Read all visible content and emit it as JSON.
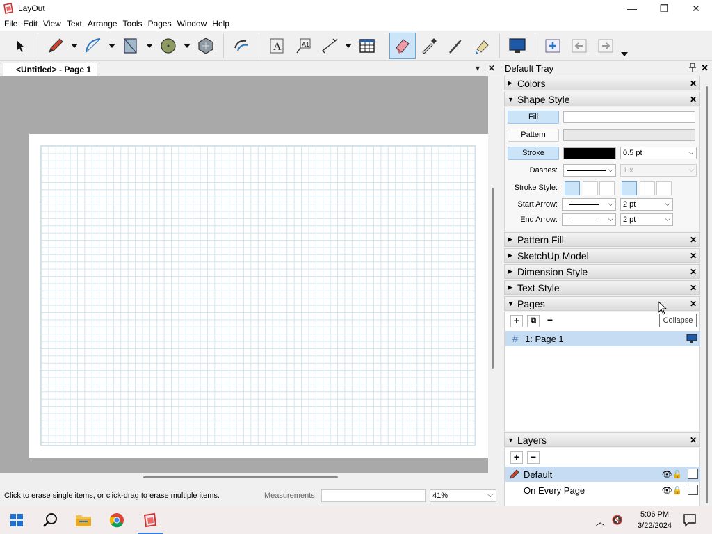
{
  "window": {
    "title": "LayOut",
    "minimize": "—",
    "maximize": "❐",
    "close": "✕"
  },
  "menu": [
    "File",
    "Edit",
    "View",
    "Text",
    "Arrange",
    "Tools",
    "Pages",
    "Window",
    "Help"
  ],
  "document": {
    "tab_label": "<Untitled> - Page 1",
    "tab_menu": "▾",
    "tab_close": "✕"
  },
  "status": {
    "hint": "Click to erase single items, or click-drag to erase multiple items.",
    "measurements_label": "Measurements",
    "measurements_value": "",
    "zoom": "41%"
  },
  "tray": {
    "title": "Default Tray",
    "pin": "📌",
    "close": "✕",
    "panels": {
      "colors": "Colors",
      "shape_style": "Shape Style",
      "pattern_fill": "Pattern Fill",
      "sketchup_model": "SketchUp Model",
      "dimension_style": "Dimension Style",
      "text_style": "Text Style",
      "pages": "Pages",
      "layers": "Layers"
    },
    "shape_style": {
      "fill_label": "Fill",
      "pattern_label": "Pattern",
      "stroke_label": "Stroke",
      "stroke_width": "0.5 pt",
      "dashes_label": "Dashes:",
      "dash_scale": "1 x",
      "stroke_style_label": "Stroke Style:",
      "start_arrow_label": "Start Arrow:",
      "start_arrow_size": "2 pt",
      "end_arrow_label": "End Arrow:",
      "end_arrow_size": "2 pt",
      "stroke_color": "#000000"
    },
    "pages": {
      "items": [
        {
          "number": "#",
          "label": "1:  Page 1"
        }
      ],
      "add": "+",
      "duplicate": "⧉",
      "remove": "−"
    },
    "layers": {
      "items": [
        {
          "label": "Default"
        },
        {
          "label": "On Every Page"
        }
      ],
      "add": "+",
      "remove": "−"
    },
    "tooltip": "Collapse"
  },
  "taskbar": {
    "time": "5:06 PM",
    "date": "3/22/2024"
  },
  "colors": {
    "accent": "#cce4f7",
    "canvas_bg": "#a9a9a9",
    "grid": "#d4e6ee"
  }
}
